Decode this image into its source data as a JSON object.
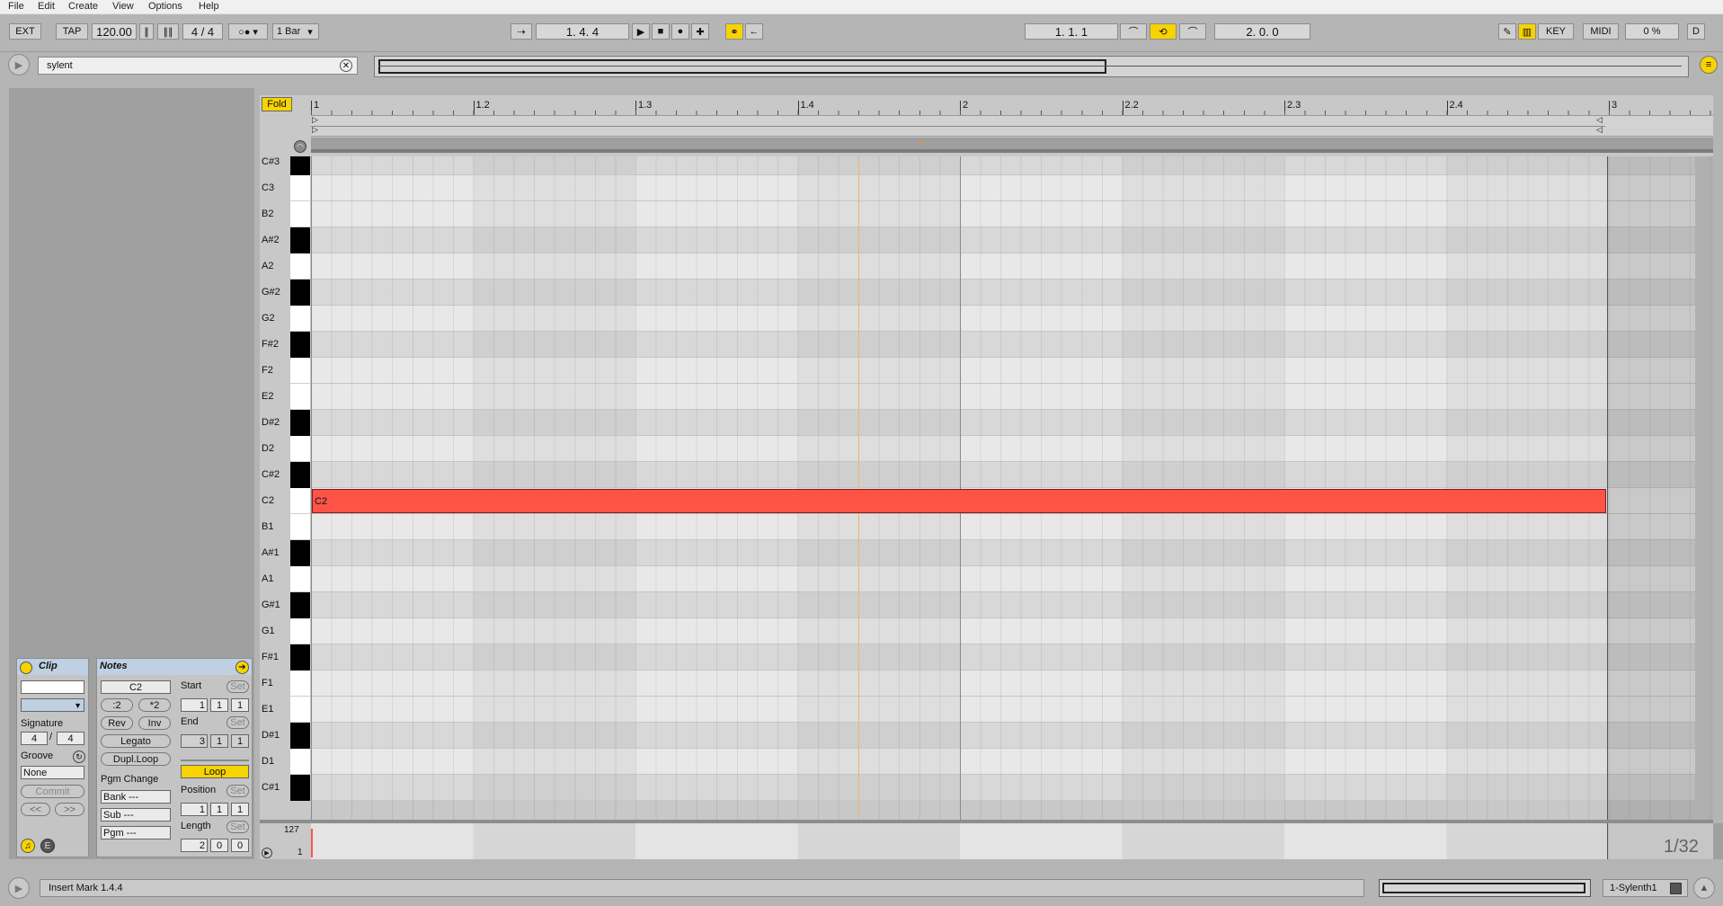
{
  "menu": [
    "File",
    "Edit",
    "Create",
    "View",
    "Options",
    "Help"
  ],
  "transport": {
    "ext": "EXT",
    "tap": "TAP",
    "tempo": "120.00",
    "signature_num": "4",
    "signature_den": "4",
    "quantize": "1 Bar",
    "position": "1.   4.   4",
    "loop_start": "1.   1.   1",
    "loop_length": "2.   0.   0",
    "key": "KEY",
    "midi": "MIDI",
    "cpu": "0 %",
    "d": "D"
  },
  "search": {
    "value": "sylent"
  },
  "clip": {
    "title": "Clip",
    "signature_label": "Signature",
    "sig_num": "4",
    "sig_den": "4",
    "groove_label": "Groove",
    "groove_value": "None",
    "commit": "Commit",
    "nav_prev": "<<",
    "nav_next": ">>"
  },
  "notes": {
    "title": "Notes",
    "pitch": "C2",
    "half": ":2",
    "double": "*2",
    "rev": "Rev",
    "inv": "Inv",
    "legato": "Legato",
    "dupl": "Dupl.Loop",
    "pgm_change": "Pgm Change",
    "bank": "Bank ---",
    "sub": "Sub ---",
    "pgm": "Pgm ---",
    "start": "Start",
    "end": "End",
    "set": "Set",
    "start_vals": [
      "1",
      "1",
      "1"
    ],
    "end_vals": [
      "3",
      "1",
      "1"
    ],
    "loop": "Loop",
    "position": "Position",
    "position_vals": [
      "1",
      "1",
      "1"
    ],
    "length": "Length",
    "length_vals": [
      "2",
      "0",
      "0"
    ]
  },
  "editor": {
    "fold": "Fold",
    "ruler": [
      "1",
      "1.2",
      "1.3",
      "1.4",
      "2",
      "2.2",
      "2.3",
      "2.4",
      "3"
    ],
    "keys": [
      "C#3",
      "C3",
      "B2",
      "A#2",
      "A2",
      "G#2",
      "G2",
      "F#2",
      "F2",
      "E2",
      "D#2",
      "D2",
      "C#2",
      "C2",
      "B1",
      "A#1",
      "A1",
      "G#1",
      "G1",
      "F#1",
      "F1",
      "E1",
      "D#1",
      "D1",
      "C#1"
    ],
    "note_label": "C2",
    "vel_max": "127",
    "vel_min": "1",
    "grid": "1/32"
  },
  "status": {
    "message": "Insert Mark 1.4.4",
    "track": "1-Sylenth1"
  },
  "colors": {
    "note": "#ff5347",
    "accent": "#f7d300"
  }
}
